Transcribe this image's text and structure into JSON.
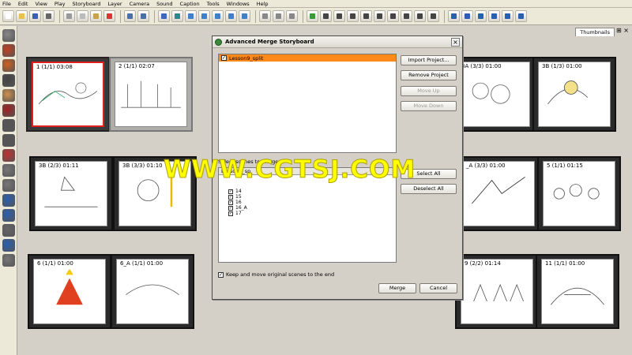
{
  "menu": [
    "File",
    "Edit",
    "View",
    "Play",
    "Storyboard",
    "Layer",
    "Camera",
    "Sound",
    "Caption",
    "Tools",
    "Windows",
    "Help"
  ],
  "thumbnails_tab": "Thumbnails",
  "panels_row1": [
    {
      "label": "1 (1/1) 03:08"
    },
    {
      "label": "2 (1/1) 02:07"
    },
    {
      "label": "3A (3/3) 01:00"
    },
    {
      "label": "3B (1/3) 01:00"
    }
  ],
  "panels_row2": [
    {
      "label": "3B (2/3) 01:11"
    },
    {
      "label": "3B (3/3) 01:10"
    },
    {
      "label": "_A (3/3) 01:00"
    },
    {
      "label": "5 (1/1) 01:15"
    }
  ],
  "panels_row3": [
    {
      "label": "6 (1/1) 01:00"
    },
    {
      "label": "6_A (1/1) 01:00"
    },
    {
      "label": "9 (2/2) 01:14"
    },
    {
      "label": "11 (1/1) 01:00"
    }
  ],
  "dialog": {
    "title": "Advanced Merge Storyboard",
    "project_item": "Lesson9_split",
    "import_button": "Import Project...",
    "remove_button": "Remove Project",
    "move_up_button": "Move Up",
    "move_down_button": "Move Down",
    "select_label": "Select scenes to merge:",
    "scene_header": "Lesson9_sp",
    "select_all_button": "Select All",
    "deselect_all_button": "Deselect All",
    "scenes": [
      "14",
      "15",
      "16",
      "16_A",
      "17"
    ],
    "keep_label": "Keep and move original scenes to the end",
    "merge_button": "Merge",
    "cancel_button": "Cancel"
  },
  "watermark": "WWW.CGTSJ.COM",
  "colors": {
    "selection": "#ff8a1a",
    "panel_selected": "#e02020",
    "watermark": "#ffff00"
  }
}
